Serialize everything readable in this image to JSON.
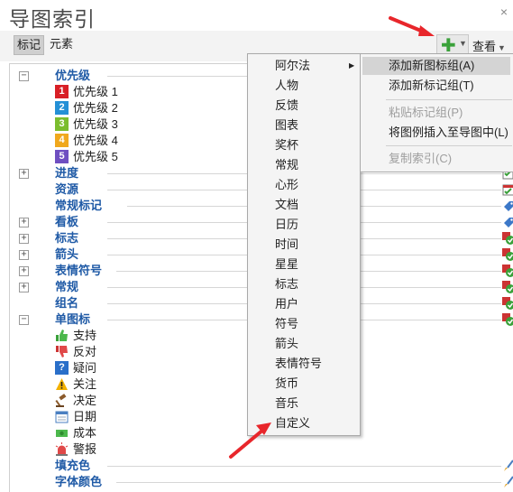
{
  "panel": {
    "title": "导图索引",
    "close_glyph": "×"
  },
  "toolbar": {
    "tabs": [
      "标记",
      "元素"
    ],
    "view_label": "查看"
  },
  "tree": {
    "priority": {
      "label": "优先级",
      "items": [
        {
          "num": "1",
          "label": "优先级 1",
          "color": "#d81f26"
        },
        {
          "num": "2",
          "label": "优先级 2",
          "color": "#2490d6"
        },
        {
          "num": "3",
          "label": "优先级 3",
          "color": "#7bbd2e"
        },
        {
          "num": "4",
          "label": "优先级 4",
          "color": "#f0a81d"
        },
        {
          "num": "5",
          "label": "优先级 5",
          "color": "#6f4fc1"
        }
      ]
    },
    "groups_mid": [
      "进度",
      "资源",
      "常规标记",
      "看板",
      "标志",
      "箭头",
      "表情符号",
      "常规",
      "组名"
    ],
    "single_icon": {
      "label": "单图标",
      "items": [
        "支持",
        "反对",
        "疑问",
        "关注",
        "决定",
        "日期",
        "成本",
        "警报"
      ]
    },
    "groups_bottom": [
      "填充色",
      "字体颜色"
    ]
  },
  "menu": {
    "items": [
      "阿尔法",
      "人物",
      "反馈",
      "图表",
      "奖杯",
      "常规",
      "心形",
      "文档",
      "日历",
      "时间",
      "星星",
      "标志",
      "用户",
      "符号",
      "箭头",
      "表情符号",
      "货币",
      "音乐",
      "自定义"
    ],
    "submenu_arrow": "▶"
  },
  "submenu": {
    "items": [
      {
        "label": "添加新图标组(A)",
        "disabled": false
      },
      {
        "label": "添加新标记组(T)",
        "disabled": false
      },
      {
        "label": "粘贴标记组(P)",
        "disabled": true
      },
      {
        "label": "将图例插入至导图中(L)",
        "disabled": false
      },
      {
        "label": "复制索引(C)",
        "disabled": true
      }
    ]
  },
  "colors": {
    "accent_green": "#3aa13a",
    "group_blue": "#1f5aa6",
    "arrow_red": "#e8262b"
  }
}
